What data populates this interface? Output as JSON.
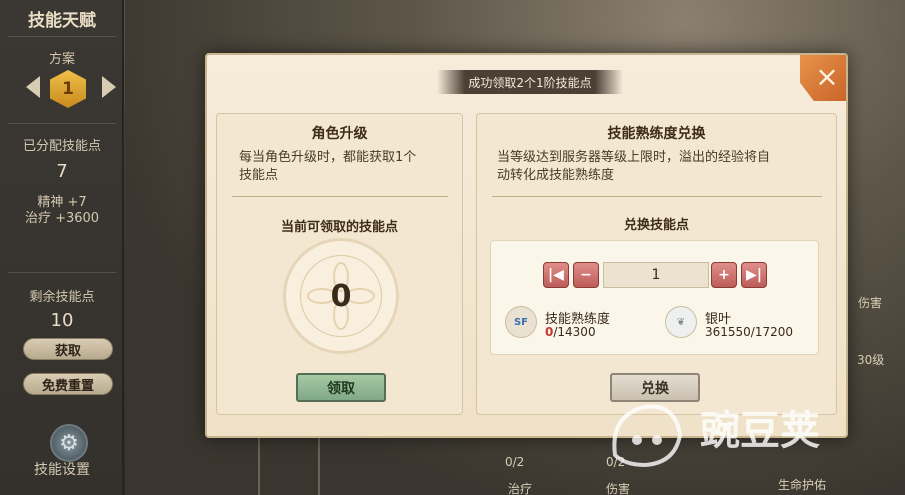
{
  "sidebar": {
    "title": "技能天赋",
    "plan_label": "方案",
    "plan_number": "1",
    "allocated_label": "已分配技能点",
    "allocated_value": "7",
    "stat1": "精神 +7",
    "stat2": "治疗 +3600",
    "remaining_label": "剩余技能点",
    "remaining_value": "10",
    "obtain_button": "获取",
    "free_reset_button": "免费重置",
    "settings_label": "技能设置"
  },
  "background_labels": {
    "damage_top": "伤害",
    "level": "30级",
    "count1": "0/2",
    "count2": "0/2",
    "heal": "治疗",
    "damage_bottom": "伤害",
    "life_protect": "生命护佑"
  },
  "modal": {
    "banner": "成功领取2个1阶技能点",
    "close_icon": "×",
    "left_panel": {
      "title": "角色升级",
      "desc_line1": "每当角色升级时，都能获取1个",
      "desc_line2": "技能点",
      "subtitle": "当前可领取的技能点",
      "points": "0",
      "button": "领取"
    },
    "right_panel": {
      "title": "技能熟练度兑换",
      "desc_line1": "当等级达到服务器等级上限时，溢出的经验将自",
      "desc_line2": "动转化成技能熟练度",
      "subtitle": "兑换技能点",
      "quantity": "1",
      "item1_label": "技能熟练度",
      "item1_have": "0",
      "item1_need": "/14300",
      "item2_label": "银叶",
      "item2_value": "361550/17200",
      "button": "兑换"
    }
  },
  "watermark": "豌豆荚",
  "colors": {
    "modal_bg": "#f6ecda",
    "green_button": "#8fb595",
    "close_button": "#d9773a",
    "stepper": "#c9625e"
  }
}
